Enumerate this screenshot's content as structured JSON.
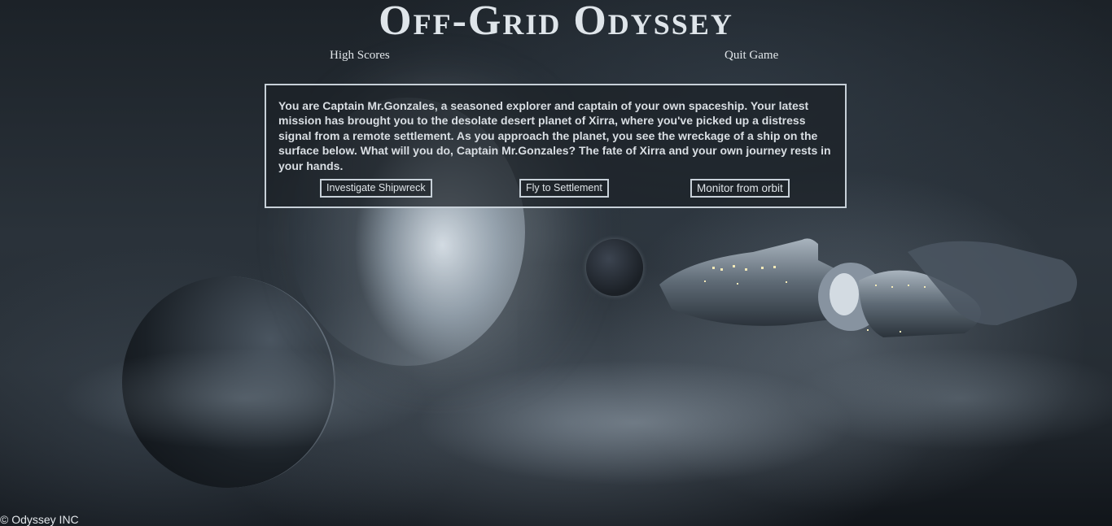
{
  "game": {
    "title": "Off-Grid Odyssey"
  },
  "nav": {
    "high_scores": "High Scores",
    "quit_game": "Quit Game"
  },
  "story": {
    "text": "You are Captain Mr.Gonzales, a seasoned explorer and captain of your own spaceship. Your latest mission has brought you to the desolate desert planet of Xirra, where you've picked up a distress signal from a remote settlement. As you approach the planet, you see the wreckage of a ship on the surface below. What will you do, Captain Mr.Gonzales? The fate of Xirra and your own journey rests in your hands.",
    "choices": [
      "Investigate Shipwreck",
      "Fly to Settlement",
      "Monitor from orbit"
    ]
  },
  "footer": {
    "copyright": "© Odyssey INC"
  }
}
